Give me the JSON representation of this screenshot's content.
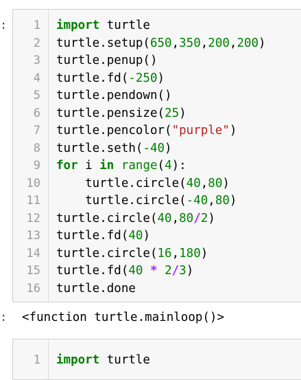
{
  "cell1": {
    "prompt": ":",
    "lines": [
      {
        "n": "1",
        "tokens": [
          {
            "t": "import",
            "c": "kw"
          },
          {
            "t": " turtle",
            "c": "p"
          }
        ]
      },
      {
        "n": "2",
        "tokens": [
          {
            "t": "turtle.setup(",
            "c": "p"
          },
          {
            "t": "650",
            "c": "num"
          },
          {
            "t": ",",
            "c": "p"
          },
          {
            "t": "350",
            "c": "num"
          },
          {
            "t": ",",
            "c": "p"
          },
          {
            "t": "200",
            "c": "num"
          },
          {
            "t": ",",
            "c": "p"
          },
          {
            "t": "200",
            "c": "num"
          },
          {
            "t": ")",
            "c": "p"
          }
        ]
      },
      {
        "n": "3",
        "tokens": [
          {
            "t": "turtle.penup()",
            "c": "p"
          }
        ]
      },
      {
        "n": "4",
        "tokens": [
          {
            "t": "turtle.fd(",
            "c": "p"
          },
          {
            "t": "-250",
            "c": "num"
          },
          {
            "t": ")",
            "c": "p"
          }
        ]
      },
      {
        "n": "5",
        "tokens": [
          {
            "t": "turtle.pendown()",
            "c": "p"
          }
        ]
      },
      {
        "n": "6",
        "tokens": [
          {
            "t": "turtle.pensize(",
            "c": "p"
          },
          {
            "t": "25",
            "c": "num"
          },
          {
            "t": ")",
            "c": "p"
          }
        ]
      },
      {
        "n": "7",
        "tokens": [
          {
            "t": "turtle.pencolor(",
            "c": "p"
          },
          {
            "t": "\"purple\"",
            "c": "str"
          },
          {
            "t": ")",
            "c": "p"
          }
        ]
      },
      {
        "n": "8",
        "tokens": [
          {
            "t": "turtle.seth(",
            "c": "p"
          },
          {
            "t": "-40",
            "c": "num"
          },
          {
            "t": ")",
            "c": "p"
          }
        ]
      },
      {
        "n": "9",
        "tokens": [
          {
            "t": "for",
            "c": "kw"
          },
          {
            "t": " i ",
            "c": "p"
          },
          {
            "t": "in",
            "c": "kw"
          },
          {
            "t": " ",
            "c": "p"
          },
          {
            "t": "range",
            "c": "bi"
          },
          {
            "t": "(",
            "c": "p"
          },
          {
            "t": "4",
            "c": "num"
          },
          {
            "t": "):",
            "c": "p"
          }
        ]
      },
      {
        "n": "10",
        "tokens": [
          {
            "t": "    turtle.circle(",
            "c": "p"
          },
          {
            "t": "40",
            "c": "num"
          },
          {
            "t": ",",
            "c": "p"
          },
          {
            "t": "80",
            "c": "num"
          },
          {
            "t": ")",
            "c": "p"
          }
        ]
      },
      {
        "n": "11",
        "tokens": [
          {
            "t": "    turtle.circle(",
            "c": "p"
          },
          {
            "t": "-40",
            "c": "num"
          },
          {
            "t": ",",
            "c": "p"
          },
          {
            "t": "80",
            "c": "num"
          },
          {
            "t": ")",
            "c": "p"
          }
        ]
      },
      {
        "n": "12",
        "tokens": [
          {
            "t": "turtle.circle(",
            "c": "p"
          },
          {
            "t": "40",
            "c": "num"
          },
          {
            "t": ",",
            "c": "p"
          },
          {
            "t": "80",
            "c": "num"
          },
          {
            "t": "/",
            "c": "op"
          },
          {
            "t": "2",
            "c": "num"
          },
          {
            "t": ")",
            "c": "p"
          }
        ]
      },
      {
        "n": "13",
        "tokens": [
          {
            "t": "turtle.fd(",
            "c": "p"
          },
          {
            "t": "40",
            "c": "num"
          },
          {
            "t": ")",
            "c": "p"
          }
        ]
      },
      {
        "n": "14",
        "tokens": [
          {
            "t": "turtle.circle(",
            "c": "p"
          },
          {
            "t": "16",
            "c": "num"
          },
          {
            "t": ",",
            "c": "p"
          },
          {
            "t": "180",
            "c": "num"
          },
          {
            "t": ")",
            "c": "p"
          }
        ]
      },
      {
        "n": "15",
        "tokens": [
          {
            "t": "turtle.fd(",
            "c": "p"
          },
          {
            "t": "40",
            "c": "num"
          },
          {
            "t": " ",
            "c": "p"
          },
          {
            "t": "*",
            "c": "op"
          },
          {
            "t": " ",
            "c": "p"
          },
          {
            "t": "2",
            "c": "num"
          },
          {
            "t": "/",
            "c": "op"
          },
          {
            "t": "3",
            "c": "num"
          },
          {
            "t": ")",
            "c": "p"
          }
        ]
      },
      {
        "n": "16",
        "tokens": [
          {
            "t": "turtle.done",
            "c": "p"
          }
        ]
      }
    ]
  },
  "output1": {
    "prompt": ":",
    "text": "<function turtle.mainloop()>"
  },
  "cell2": {
    "lines": [
      {
        "n": "1",
        "tokens": [
          {
            "t": "import",
            "c": "kw"
          },
          {
            "t": " turtle",
            "c": "p"
          }
        ]
      }
    ]
  }
}
